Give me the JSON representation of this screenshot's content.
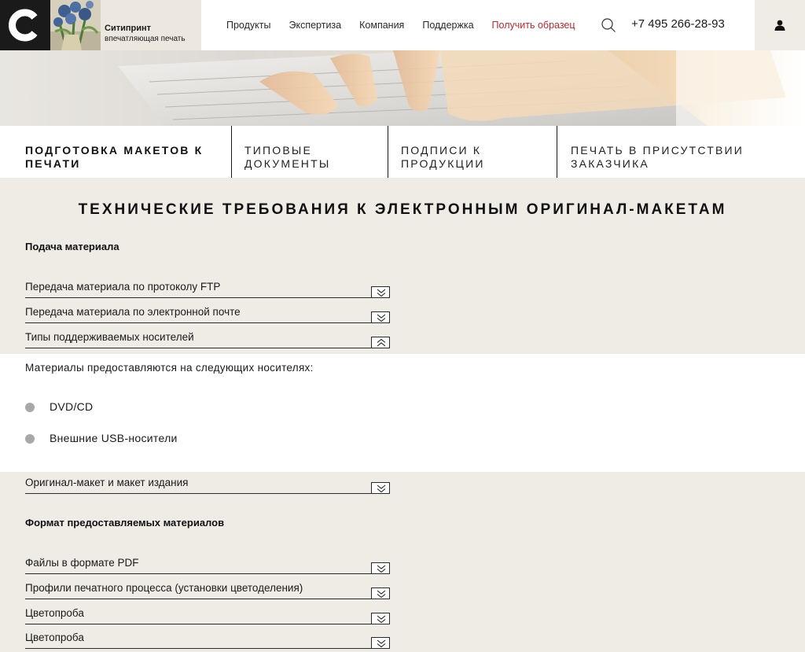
{
  "header": {
    "brand_name": "Ситипринт",
    "brand_tagline": "впечатляющая печать",
    "nav": [
      "Продукты",
      "Экспертиза",
      "Компания",
      "Поддержка"
    ],
    "sample_link": "Получить образец",
    "phone": "+7 495 266-28-93",
    "accent_color": "#c1272d"
  },
  "tabs": [
    "ПОДГОТОВКА МАКЕТОВ К ПЕЧАТИ",
    "ТИПОВЫЕ ДОКУМЕНТЫ",
    "ПОДПИСИ К ПРОДУКЦИИ",
    "ПЕЧАТЬ В ПРИСУТСТВИИ ЗАКАЗЧИКА"
  ],
  "main": {
    "title": "ТЕХНИЧЕСКИЕ ТРЕБОВАНИЯ К ЭЛЕКТРОННЫМ ОРИГИНАЛ-МАКЕТАМ",
    "section1": {
      "title": "Подача материала",
      "items": [
        {
          "label": "Передача материала по протоколу FTP",
          "icon": "chevron-down-icon"
        },
        {
          "label": "Передача материала по электронной почте",
          "icon": "chevron-down-icon"
        },
        {
          "label": "Типы поддерживаемых носителей",
          "icon": "chevron-up-icon"
        }
      ],
      "expanded": {
        "intro": "Материалы предоставляются на следующих носителях:",
        "bullets": [
          "DVD/CD",
          "Внешние USB-носители"
        ]
      },
      "after_item": "Оригинал-макет и макет издания"
    },
    "section2": {
      "title": "Формат предоставляемых материалов",
      "items": [
        "Файлы в формате PDF",
        "Профили печатного процесса (установки цветоделения)",
        "Цветопроба",
        "Цветопроба"
      ]
    }
  }
}
